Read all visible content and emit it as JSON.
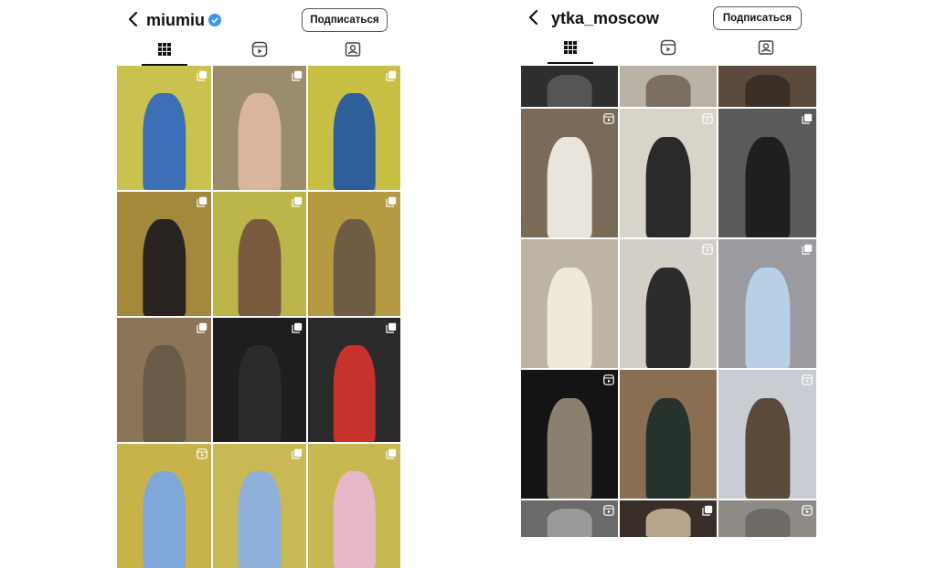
{
  "left": {
    "username": "miumiu",
    "verified": true,
    "follow_label": "Подписаться",
    "tabs": [
      "posts-grid-icon",
      "reels-icon",
      "tagged-icon"
    ],
    "tiles": [
      {
        "bg": "#c9c24e",
        "fg": "#3c6fb6",
        "badge": "multi"
      },
      {
        "bg": "#9b8c6c",
        "fg": "#d9b5a0",
        "badge": "multi"
      },
      {
        "bg": "#c8bf45",
        "fg": "#2f5f9a",
        "badge": "multi"
      },
      {
        "bg": "#a4883c",
        "fg": "#2a2420",
        "badge": "multi"
      },
      {
        "bg": "#bcb64a",
        "fg": "#7a5a3c",
        "badge": "multi"
      },
      {
        "bg": "#b59a42",
        "fg": "#6e5c44",
        "badge": "multi"
      },
      {
        "bg": "#8c7457",
        "fg": "#6a5a48",
        "badge": "multi"
      },
      {
        "bg": "#1e1e1e",
        "fg": "#2b2b2b",
        "badge": "multi"
      },
      {
        "bg": "#2a2a2a",
        "fg": "#c8322c",
        "badge": "multi"
      },
      {
        "bg": "#c8b34a",
        "fg": "#7fa7d8",
        "badge": "reel"
      },
      {
        "bg": "#c9b856",
        "fg": "#8fb0d8",
        "badge": "multi"
      },
      {
        "bg": "#c7b852",
        "fg": "#e6b8c8",
        "badge": "multi"
      }
    ]
  },
  "right": {
    "username": "ytka_moscow",
    "follow_label": "Подписаться",
    "tabs": [
      "posts-grid-icon",
      "reels-icon",
      "tagged-icon"
    ],
    "tiles": [
      {
        "bg": "#2e2e2e",
        "fg": "#555555",
        "badge": "none"
      },
      {
        "bg": "#b9b2a6",
        "fg": "#7a6f60",
        "badge": "none"
      },
      {
        "bg": "#5c4a3e",
        "fg": "#3a2e26",
        "badge": "none"
      },
      {
        "bg": "#7a6a58",
        "fg": "#e9e4dc",
        "badge": "reel"
      },
      {
        "bg": "#d9d4ca",
        "fg": "#2a2a2a",
        "badge": "reel"
      },
      {
        "bg": "#5a5a5a",
        "fg": "#1f1f1f",
        "badge": "multi"
      },
      {
        "bg": "#bdb4a6",
        "fg": "#efe9dc",
        "badge": "none"
      },
      {
        "bg": "#d4cfc6",
        "fg": "#2c2c2c",
        "badge": "reel"
      },
      {
        "bg": "#9a9aa0",
        "fg": "#b8d0e6",
        "badge": "multi"
      },
      {
        "bg": "#141414",
        "fg": "#8a8070",
        "badge": "reel"
      },
      {
        "bg": "#8a6e52",
        "fg": "#26332c",
        "badge": "none"
      },
      {
        "bg": "#c9ccd2",
        "fg": "#5a4a3a",
        "badge": "reel"
      },
      {
        "bg": "#6a6a6a",
        "fg": "#9a9a9a",
        "badge": "reel"
      },
      {
        "bg": "#3a2f28",
        "fg": "#b7a58e",
        "badge": "multi"
      },
      {
        "bg": "#8e8a86",
        "fg": "#6e6a66",
        "badge": "reel"
      }
    ]
  }
}
